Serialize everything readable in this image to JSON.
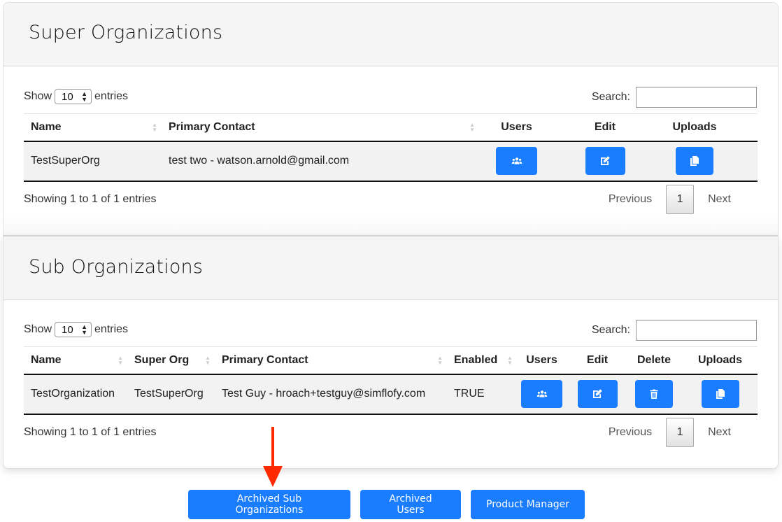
{
  "super_orgs": {
    "title": "Super Organizations",
    "length": {
      "show_label": "Show",
      "value": "10",
      "entries_label": "entries"
    },
    "search": {
      "label": "Search:",
      "value": "",
      "placeholder": ""
    },
    "columns": [
      "Name",
      "Primary Contact",
      "Users",
      "Edit",
      "Uploads"
    ],
    "rows": [
      {
        "name": "TestSuperOrg",
        "primary_contact": "test two - watson.arnold@gmail.com"
      }
    ],
    "info": "Showing 1 to 1 of 1 entries",
    "pagination": {
      "previous": "Previous",
      "current": "1",
      "next": "Next"
    }
  },
  "sub_orgs": {
    "title": "Sub Organizations",
    "length": {
      "show_label": "Show",
      "value": "10",
      "entries_label": "entries"
    },
    "search": {
      "label": "Search:",
      "value": "",
      "placeholder": ""
    },
    "columns": [
      "Name",
      "Super Org",
      "Primary Contact",
      "Enabled",
      "Users",
      "Edit",
      "Delete",
      "Uploads"
    ],
    "rows": [
      {
        "name": "TestOrganization",
        "super_org": "TestSuperOrg",
        "primary_contact": "Test Guy - hroach+testguy@simflofy.com",
        "enabled": "TRUE"
      }
    ],
    "info": "Showing 1 to 1 of 1 entries",
    "pagination": {
      "previous": "Previous",
      "current": "1",
      "next": "Next"
    }
  },
  "footer": {
    "buttons": [
      "Archived Sub Organizations",
      "Archived Users",
      "Product Manager"
    ]
  },
  "icons": {
    "users": "users-icon",
    "edit": "edit-icon",
    "delete": "trash-icon",
    "uploads": "copy-icon",
    "annotation": "red-arrow-down-icon"
  },
  "colors": {
    "primary": "#1a7cff",
    "annotation": "#ff2a00"
  }
}
